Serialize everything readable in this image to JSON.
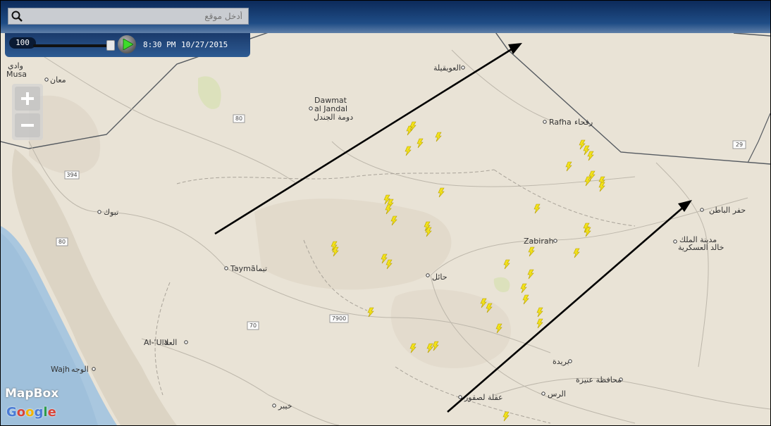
{
  "search": {
    "placeholder": "أدخل موقع"
  },
  "playback": {
    "speed": "100",
    "time": "8:30 PM",
    "date": "10/27/2015"
  },
  "attribution": {
    "mapbox": "MapBox",
    "google": "Google"
  },
  "places": [
    {
      "name": "Dawmat",
      "kind": "city"
    },
    {
      "name": "al Jandal",
      "kind": "city"
    },
    {
      "name": "دومة الجندل",
      "kind": "city"
    },
    {
      "name": "العويقيلة",
      "kind": "town"
    },
    {
      "name": "Rafha",
      "kind": "city"
    },
    {
      "name": "رفحاء",
      "kind": "city"
    },
    {
      "name": "معان",
      "kind": "town"
    },
    {
      "name": "وادي",
      "kind": "town"
    },
    {
      "name": "Musa",
      "kind": "town"
    },
    {
      "name": "تبوك",
      "kind": "city"
    },
    {
      "name": "Taymā",
      "kind": "city"
    },
    {
      "name": "تيما",
      "kind": "city"
    },
    {
      "name": "حائل",
      "kind": "city"
    },
    {
      "name": "Zabirah",
      "kind": "town"
    },
    {
      "name": "حفر الباطن",
      "kind": "city"
    },
    {
      "name": "مدينة الملك",
      "kind": "city"
    },
    {
      "name": "خالد العسكرية",
      "kind": "city"
    },
    {
      "name": "Al-'Ula",
      "kind": "city"
    },
    {
      "name": "العلا",
      "kind": "city"
    },
    {
      "name": "Wajh",
      "kind": "city"
    },
    {
      "name": "الوجه",
      "kind": "city"
    },
    {
      "name": "بريدة",
      "kind": "city"
    },
    {
      "name": "محافظة عنيزة",
      "kind": "city"
    },
    {
      "name": "الرس",
      "kind": "town"
    },
    {
      "name": "عقلة لصقور",
      "kind": "town"
    },
    {
      "name": "خيبر",
      "kind": "town"
    }
  ],
  "road_shields": [
    "80",
    "394",
    "80",
    "70",
    "7900",
    "29"
  ],
  "icons": [
    "search-icon",
    "play-icon",
    "zoom-in-icon",
    "zoom-out-icon",
    "lightning-icon",
    "arrow-icon"
  ],
  "colors": {
    "lightning": "#f2e21a",
    "sea": "#a9c7df",
    "land": "#e9e3d6",
    "border": "#555a60",
    "arrow": "#000000",
    "header": "#1f4d86"
  }
}
